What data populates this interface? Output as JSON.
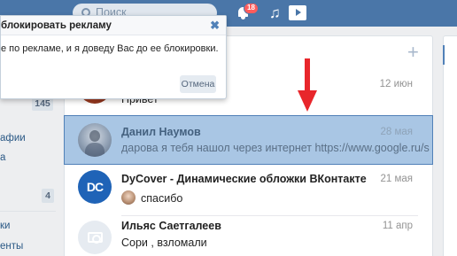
{
  "header": {
    "search_placeholder": "Поиск",
    "notifications_count": "18"
  },
  "sidebar": {
    "count_top": "145",
    "item_photos_fragment": "афии",
    "item_a_fragment": "а",
    "count_bottom": "4",
    "item_ki_fragment": "ки",
    "item_enty_fragment": "енты"
  },
  "popup": {
    "title": "блокировать рекламу",
    "body": "е по рекламе, и я доведу Вас до ее блокировки.",
    "cancel_label": "Отмена"
  },
  "dialogs": [
    {
      "name": "",
      "message": "Привет",
      "date": "12 июн"
    },
    {
      "name": "Данил Наумов",
      "message": "дарова я тебя нашол через интернет https://www.google.ru/s",
      "date": "28 мая"
    },
    {
      "name": "DyCover - Динамические обложки ВКонтакте",
      "message": "спасибо",
      "date": "21 мая",
      "avatar_text": "DC"
    },
    {
      "name": "Ильяс Саетгалеев",
      "message": "Сори , взломали",
      "date": "11 апр"
    }
  ],
  "colors": {
    "header_bg": "#4a76a8",
    "highlight_bg": "#a9c6e4",
    "arrow": "#e8262b"
  }
}
